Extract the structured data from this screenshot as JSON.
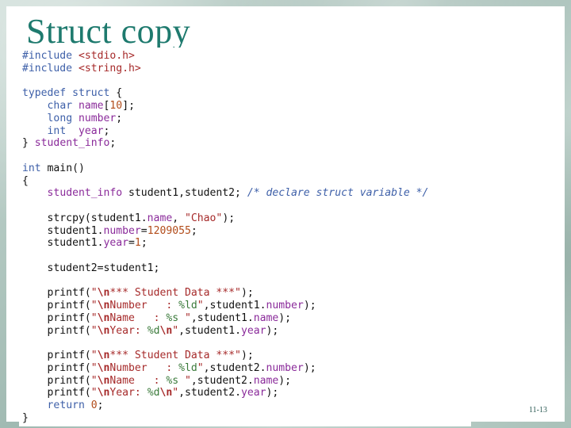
{
  "slide": {
    "title": "Struct copy",
    "page_number": "11-13"
  },
  "code_lines": [
    "#include <stdio.h>",
    "#include <string.h>",
    "",
    "typedef struct {",
    "    char name[10];",
    "    long number;",
    "    int  year;",
    "} student_info;",
    "",
    "int main()",
    "{",
    "    student_info student1,student2; /* declare struct variable */",
    "",
    "    strcpy(student1.name, \"Chao\");",
    "    student1.number=1209055;",
    "    student1.year=1;",
    "",
    "    student2=student1;",
    "",
    "    printf(\"\\n*** Student Data ***\");",
    "    printf(\"\\nNumber   : %ld\",student1.number);",
    "    printf(\"\\nName   : %s \",student1.name);",
    "    printf(\"\\nYear: %d\\n\",student1.year);",
    "",
    "    printf(\"\\n*** Student Data ***\");",
    "    printf(\"\\nNumber   : %ld\",student2.number);",
    "    printf(\"\\nName   : %s \",student2.name);",
    "    printf(\"\\nYear: %d\\n\",student2.year);",
    "    return 0;",
    "}"
  ],
  "colors": {
    "title": "#1e7a6e",
    "keyword": "#3d5fa8",
    "string": "#a62a2a",
    "number": "#b24c1a",
    "member": "#8a2a9a"
  }
}
